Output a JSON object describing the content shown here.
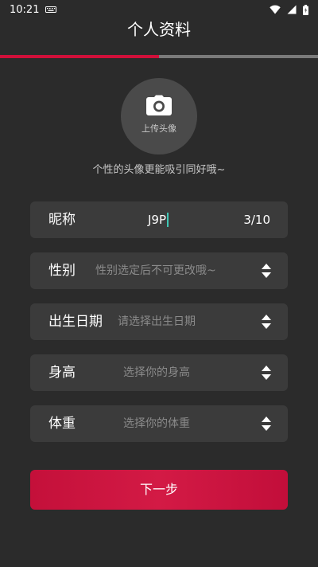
{
  "status_bar": {
    "time": "10:21",
    "icons": [
      "keyboard-icon",
      "wifi-icon",
      "signal-icon",
      "battery-icon"
    ]
  },
  "header": {
    "title": "个人资料"
  },
  "progress": {
    "fraction": 0.5,
    "fill_color": "#d0103a",
    "track_color": "#7a7a7a"
  },
  "avatar": {
    "icon": "camera-icon",
    "label": "上传头像",
    "hint": "个性的头像更能吸引同好哦~"
  },
  "form": {
    "nickname": {
      "label": "昵称",
      "value": "J9P",
      "counter": "3/10"
    },
    "gender": {
      "label": "性别",
      "placeholder": "性别选定后不可更改哦~"
    },
    "birthdate": {
      "label": "出生日期",
      "placeholder": "请选择出生日期"
    },
    "height": {
      "label": "身高",
      "placeholder": "选择你的身高"
    },
    "weight": {
      "label": "体重",
      "placeholder": "选择你的体重"
    }
  },
  "actions": {
    "next_label": "下一步"
  },
  "colors": {
    "background": "#2b2b2b",
    "field_background": "#3b3b3b",
    "accent": "#d0103a",
    "caret": "#3fc7b5"
  }
}
